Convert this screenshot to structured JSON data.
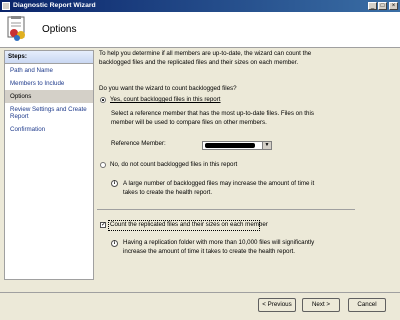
{
  "window": {
    "title": "Diagnostic Report Wizard",
    "controls": {
      "minimize": "_",
      "maximize": "□",
      "close": "×"
    }
  },
  "header": {
    "title": "Options",
    "icon": "report-wizard-icon"
  },
  "steps": {
    "heading": "Steps:",
    "items": [
      {
        "label": "Path and Name"
      },
      {
        "label": "Members to Include"
      },
      {
        "label": "Options"
      },
      {
        "label": "Review Settings and Create Report"
      },
      {
        "label": "Confirmation"
      }
    ],
    "active_index": 2
  },
  "content": {
    "intro": "To help you determine if all members are up-to-date, the wizard can count the backlogged files and the replicated files and their sizes on each member.",
    "question": "Do you want the wizard to count backlogged files?",
    "radio_yes": {
      "label": "Yes, count backlogged files in this report",
      "checked": true
    },
    "yes_description": "Select a reference member that has the most up-to-date files. Files on this member will be used to compare files on other members.",
    "reference_member": {
      "label": "Reference Member:",
      "value": ""
    },
    "radio_no": {
      "label": "No, do not count backlogged files in this report",
      "checked": false
    },
    "backlog_note": "A large number of backlogged files may increase the amount of time it takes to create the health report.",
    "checkbox_count": {
      "label": "Count the replicated files and their sizes on each member",
      "checked": true
    },
    "replication_note": "Having a replication folder with more than 10,000 files will significantly increase the amount of time it takes to create the health report."
  },
  "buttons": {
    "previous": "< Previous",
    "next": "Next >",
    "cancel": "Cancel"
  }
}
